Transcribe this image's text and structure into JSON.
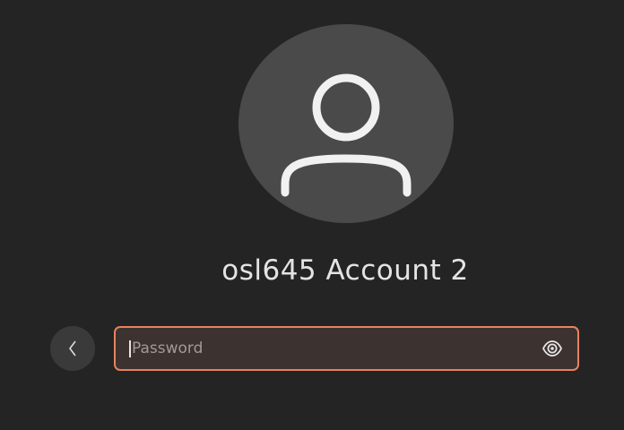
{
  "login": {
    "avatar_icon": "user-avatar-icon",
    "username": "osl645 Account 2",
    "back_icon": "chevron-left-icon",
    "password": {
      "value": "",
      "placeholder": "Password",
      "reveal_icon": "eye-icon"
    }
  },
  "colors": {
    "background": "#242424",
    "avatar_background": "#4a4a4a",
    "field_border_accent": "#e9825e",
    "field_background": "#3c3331",
    "text": "#e4e4e4"
  }
}
